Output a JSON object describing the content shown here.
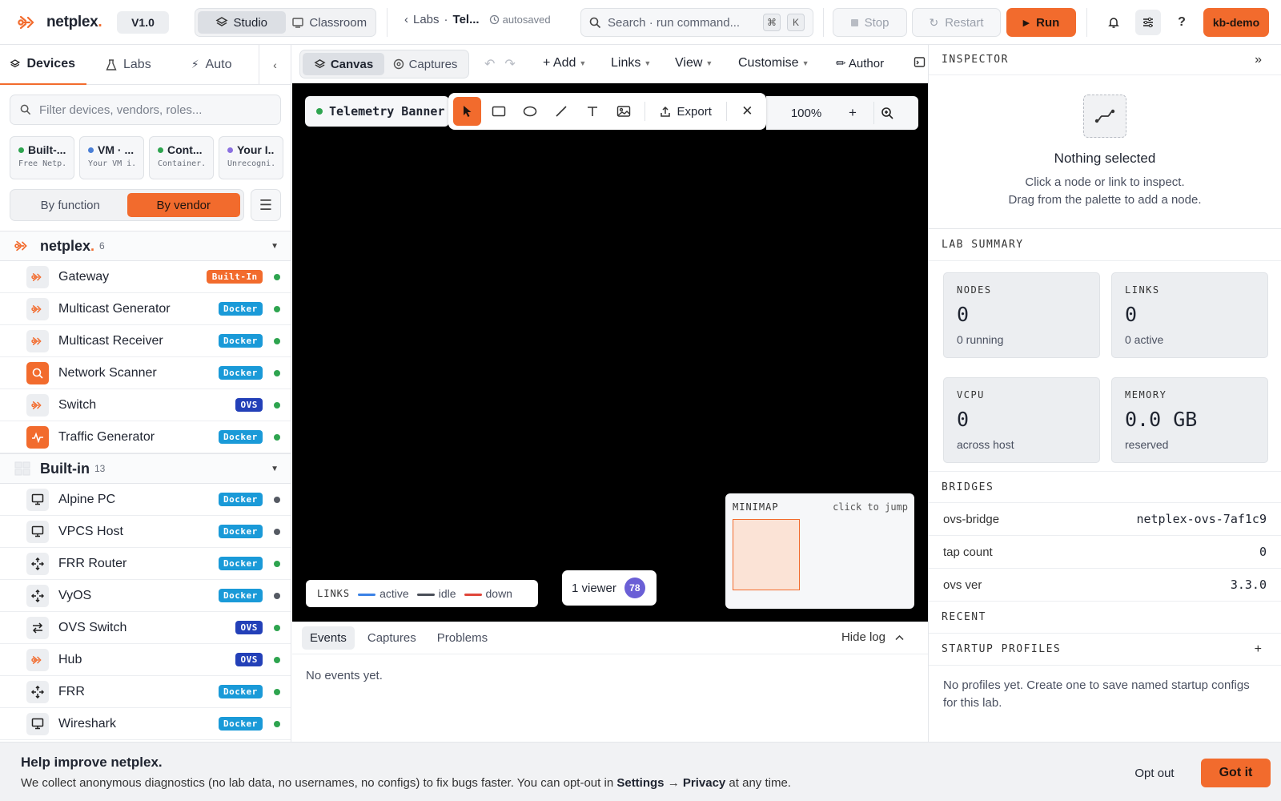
{
  "topbar": {
    "brand": "netplex",
    "brand_dot": ".",
    "version": "V1.0",
    "modes": [
      "Studio",
      "Classroom"
    ],
    "breadcrumb_labs": "Labs",
    "breadcrumb_sep": "·",
    "breadcrumb_current": "Tel...",
    "autosaved": "autosaved",
    "search_placeholder": "Search · run command...",
    "search_kbd": [
      "⌘",
      "K"
    ],
    "stop": "Stop",
    "restart": "Restart",
    "run": "Run",
    "user": "kb-demo"
  },
  "sidebar": {
    "tabs": [
      "Devices",
      "Labs",
      "Auto"
    ],
    "filter_placeholder": "Filter devices, vendors, roles...",
    "chips": [
      {
        "title": "Built-...",
        "sub": "Free Netp...",
        "color": "#2ea44f"
      },
      {
        "title": "VM · ...",
        "sub": "Your VM i...",
        "color": "#4a7fd6"
      },
      {
        "title": "Cont...",
        "sub": "Container...",
        "color": "#2ea44f"
      },
      {
        "title": "Your I...",
        "sub": "Unrecogni...",
        "color": "#8a70e0"
      }
    ],
    "group_by": [
      "By function",
      "By vendor"
    ],
    "groups": [
      {
        "name": "netplex",
        "dot": ".",
        "count": "6",
        "items": [
          {
            "name": "Gateway",
            "badge": "Built-In",
            "badge_color": "#f26b2d",
            "status": "#2ea44f",
            "icon": "netplex-icon"
          },
          {
            "name": "Multicast Generator",
            "badge": "Docker",
            "badge_color": "#1a9ad8",
            "status": "#2ea44f",
            "icon": "netplex-icon"
          },
          {
            "name": "Multicast Receiver",
            "badge": "Docker",
            "badge_color": "#1a9ad8",
            "status": "#2ea44f",
            "icon": "netplex-icon"
          },
          {
            "name": "Network Scanner",
            "badge": "Docker",
            "badge_color": "#1a9ad8",
            "status": "#2ea44f",
            "icon": "scan-icon"
          },
          {
            "name": "Switch",
            "badge": "OVS",
            "badge_color": "#2340b8",
            "status": "#2ea44f",
            "icon": "netplex-icon"
          },
          {
            "name": "Traffic Generator",
            "badge": "Docker",
            "badge_color": "#1a9ad8",
            "status": "#2ea44f",
            "icon": "pulse-icon"
          }
        ]
      },
      {
        "name": "Built-in",
        "dot": "",
        "count": "13",
        "items": [
          {
            "name": "Alpine PC",
            "badge": "Docker",
            "badge_color": "#1a9ad8",
            "status": "#555a63",
            "icon": "monitor-icon"
          },
          {
            "name": "VPCS Host",
            "badge": "Docker",
            "badge_color": "#1a9ad8",
            "status": "#555a63",
            "icon": "monitor-icon"
          },
          {
            "name": "FRR Router",
            "badge": "Docker",
            "badge_color": "#1a9ad8",
            "status": "#2ea44f",
            "icon": "router-icon"
          },
          {
            "name": "VyOS",
            "badge": "Docker",
            "badge_color": "#1a9ad8",
            "status": "#555a63",
            "icon": "router-icon"
          },
          {
            "name": "OVS Switch",
            "badge": "OVS",
            "badge_color": "#2340b8",
            "status": "#2ea44f",
            "icon": "switch-icon"
          },
          {
            "name": "Hub",
            "badge": "OVS",
            "badge_color": "#2340b8",
            "status": "#2ea44f",
            "icon": "netplex-icon"
          },
          {
            "name": "FRR",
            "badge": "Docker",
            "badge_color": "#1a9ad8",
            "status": "#2ea44f",
            "icon": "router-icon"
          },
          {
            "name": "Wireshark",
            "badge": "Docker",
            "badge_color": "#1a9ad8",
            "status": "#2ea44f",
            "icon": "monitor-icon"
          }
        ]
      }
    ]
  },
  "canvas_toolbar": {
    "views": [
      "Canvas",
      "Captures"
    ],
    "menus": [
      "+ Add",
      "Links",
      "View",
      "Customise"
    ],
    "author": "✏ Author"
  },
  "canvas": {
    "title": "Telemetry Banner",
    "export": "Export",
    "zoom": "100%",
    "zoom_in": "+",
    "legend_title": "LINKS",
    "legend": [
      {
        "label": "active",
        "color": "#3b82e6"
      },
      {
        "label": "idle",
        "color": "#4a4f58"
      },
      {
        "label": "down",
        "color": "#e0463a"
      }
    ],
    "viewers": "1 viewer",
    "viewer_count": "78",
    "minimap_title": "MINIMAP",
    "minimap_hint": "click to jump"
  },
  "log": {
    "tabs": [
      "Events",
      "Captures",
      "Problems"
    ],
    "hide": "Hide log",
    "empty": "No events yet."
  },
  "inspector": {
    "title": "INSPECTOR",
    "collapse": "»",
    "empty_title": "Nothing selected",
    "empty_line1": "Click a node or link to inspect.",
    "empty_line2": "Drag from the palette to add a node.",
    "summary_title": "LAB SUMMARY",
    "stats": [
      {
        "label": "NODES",
        "value": "0",
        "sub": "0 running"
      },
      {
        "label": "LINKS",
        "value": "0",
        "sub": "0 active"
      },
      {
        "label": "VCPU",
        "value": "0",
        "sub": "across host"
      },
      {
        "label": "MEMORY",
        "value": "0.0 GB",
        "sub": "reserved"
      }
    ],
    "bridges_title": "BRIDGES",
    "bridges": [
      {
        "key": "ovs-bridge",
        "value": "netplex-ovs-7af1c9"
      },
      {
        "key": "tap count",
        "value": "0"
      },
      {
        "key": "ovs ver",
        "value": "3.3.0"
      }
    ],
    "recent_title": "RECENT",
    "profiles_title": "STARTUP PROFILES",
    "profiles_add": "+",
    "profiles_empty": "No profiles yet. Create one to save named startup configs for this lab."
  },
  "banner": {
    "title": "Help improve netplex.",
    "text_before": "We collect anonymous diagnostics (no lab data, no usernames, no configs) to fix bugs faster. You can opt-out in ",
    "text_bold1": "Settings",
    "text_arrow": " → ",
    "text_bold2": "Privacy",
    "text_after": " at any time.",
    "opt_out": "Opt out",
    "got_it": "Got it"
  },
  "colors": {
    "accent": "#f26b2d"
  }
}
